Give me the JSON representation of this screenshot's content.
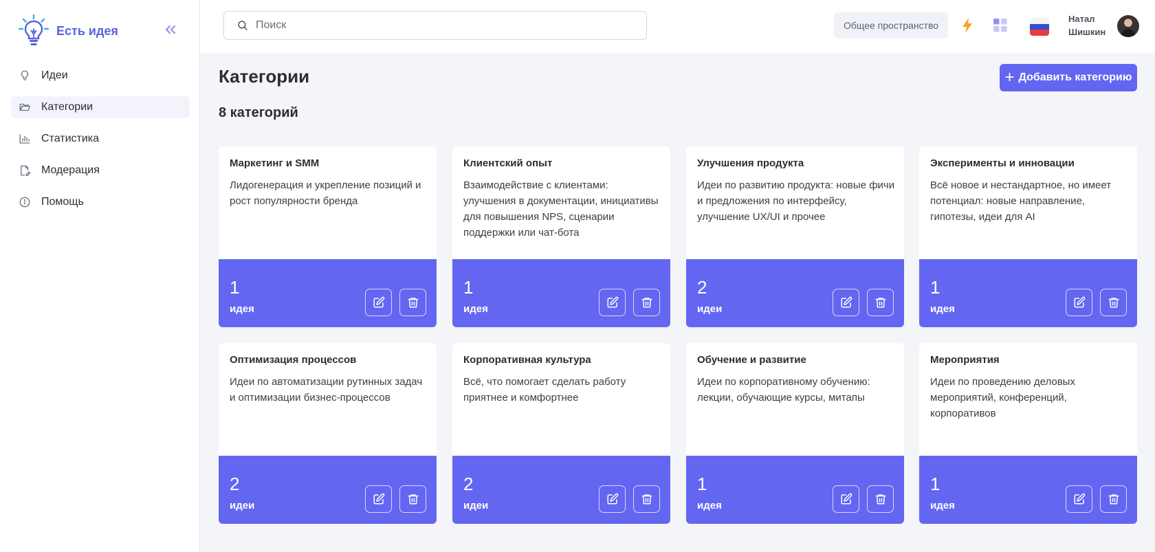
{
  "app": {
    "logo_text": "Есть идея"
  },
  "sidebar": {
    "items": [
      {
        "label": "Идеи",
        "icon": "lightbulb-icon",
        "active": false
      },
      {
        "label": "Категории",
        "icon": "folder-icon",
        "active": true
      },
      {
        "label": "Статистика",
        "icon": "bar-chart-icon",
        "active": false
      },
      {
        "label": "Модерация",
        "icon": "moderation-icon",
        "active": false
      },
      {
        "label": "Помощь",
        "icon": "info-icon",
        "active": false
      }
    ]
  },
  "header": {
    "search_placeholder": "Поиск",
    "workspace_label": "Общее пространство",
    "user_first": "Натал",
    "user_last": "Шишкин"
  },
  "main": {
    "title": "Категории",
    "add_button_label": "Добавить категорию",
    "count_label": "8 категорий"
  },
  "categories": [
    {
      "title": "Маркетинг и SMM",
      "description": "Лидогенерация и укрепление позиций и рост популярности бренда",
      "count": "1",
      "unit": "идея"
    },
    {
      "title": "Клиентский опыт",
      "description": "Взаимодействие с клиентами: улучшения в документации, инициативы для повышения NPS, сценарии поддержки или чат-бота",
      "count": "1",
      "unit": "идея"
    },
    {
      "title": "Улучшения продукта",
      "description": "Идеи по развитию продукта: новые фичи и предложения по интерфейсу, улучшение UX/UI и прочее",
      "count": "2",
      "unit": "идеи"
    },
    {
      "title": "Эксперименты и инновации",
      "description": "Всё новое и нестандартное, но имеет потенциал: новые направление, гипотезы, идеи для AI",
      "count": "1",
      "unit": "идея"
    },
    {
      "title": "Оптимизация процессов",
      "description": "Идеи по автоматизации рутинных задач и оптимизации бизнес-процессов",
      "count": "2",
      "unit": "идеи"
    },
    {
      "title": "Корпоративная культура",
      "description": "Всё, что помогает сделать работу приятнее и комфортнее",
      "count": "2",
      "unit": "идеи"
    },
    {
      "title": "Обучение и развитие",
      "description": "Идеи по корпоративному обучению: лекции, обучающие курсы, митапы",
      "count": "1",
      "unit": "идея"
    },
    {
      "title": "Мероприятия",
      "description": "Идеи по проведению деловых мероприятий, конференций, корпоративов",
      "count": "1",
      "unit": "идея"
    }
  ],
  "colors": {
    "accent": "#6366f1",
    "logo": "#5a63d8",
    "bolt": "#f5a524"
  }
}
